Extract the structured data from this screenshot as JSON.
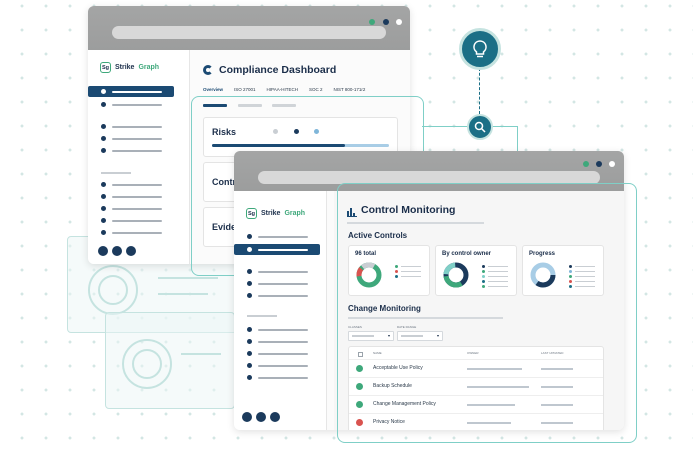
{
  "brand": {
    "prefix": "Sg",
    "name_1": "Strike",
    "name_2": "Graph"
  },
  "colors": {
    "primary": "#1b4a73",
    "accent": "#3ea87b",
    "teal": "#1b6f86",
    "dot_green": "#3ea87b",
    "dot_navy": "#1b3a5c"
  },
  "back_window": {
    "title": "Compliance Dashboard",
    "tabs": [
      "Overview",
      "ISO 27001",
      "HIPAA-HITECH",
      "SOC 2",
      "NIST 800-171r2"
    ],
    "cards": [
      {
        "label": "Risks",
        "progress": 0.75
      },
      {
        "label": "Contr"
      },
      {
        "label": "Evide"
      }
    ]
  },
  "front_window": {
    "title": "Control Monitoring",
    "active_controls": {
      "heading": "Active Controls",
      "cards": [
        {
          "label": "96 total",
          "legend_colors": [
            "#3ea87b",
            "#d9534f",
            "#1b6f86"
          ]
        },
        {
          "label": "By control owner",
          "legend_colors": [
            "#1b3a5c",
            "#3ea87b",
            "#7fcfc7",
            "#1b6f86",
            "#3ea87b"
          ]
        },
        {
          "label": "Progress",
          "legend_colors": [
            "#1b3a5c",
            "#7fb6d9",
            "#3ea87b",
            "#d9534f",
            "#1b6f86"
          ]
        }
      ]
    },
    "change_monitoring": {
      "heading": "Change Monitoring",
      "filters": [
        "Classes",
        "Date range"
      ],
      "columns": [
        "Name",
        "Owner",
        "Last updated"
      ],
      "rows": [
        {
          "name": "Acceptable Use Policy",
          "status": "green"
        },
        {
          "name": "Backup Schedule",
          "status": "green"
        },
        {
          "name": "Change Management Policy",
          "status": "green"
        },
        {
          "name": "Privacy Notice",
          "status": "red"
        }
      ]
    }
  }
}
